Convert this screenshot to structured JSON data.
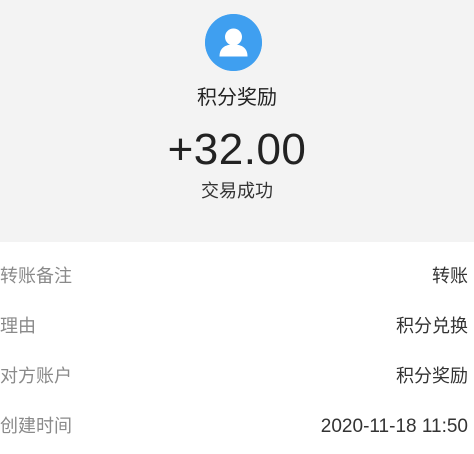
{
  "summary": {
    "avatar_icon": "user-avatar-icon",
    "avatar_color": "#3f9ff0",
    "merchant": "积分奖励",
    "amount": "+32.00",
    "status": "交易成功"
  },
  "details": [
    {
      "label": "转账备注",
      "value": "转账"
    },
    {
      "label": "理由",
      "value": "积分兑换"
    },
    {
      "label": "对方账户",
      "value": "积分奖励"
    },
    {
      "label": "创建时间",
      "value": "2020-11-18 11:50"
    }
  ]
}
